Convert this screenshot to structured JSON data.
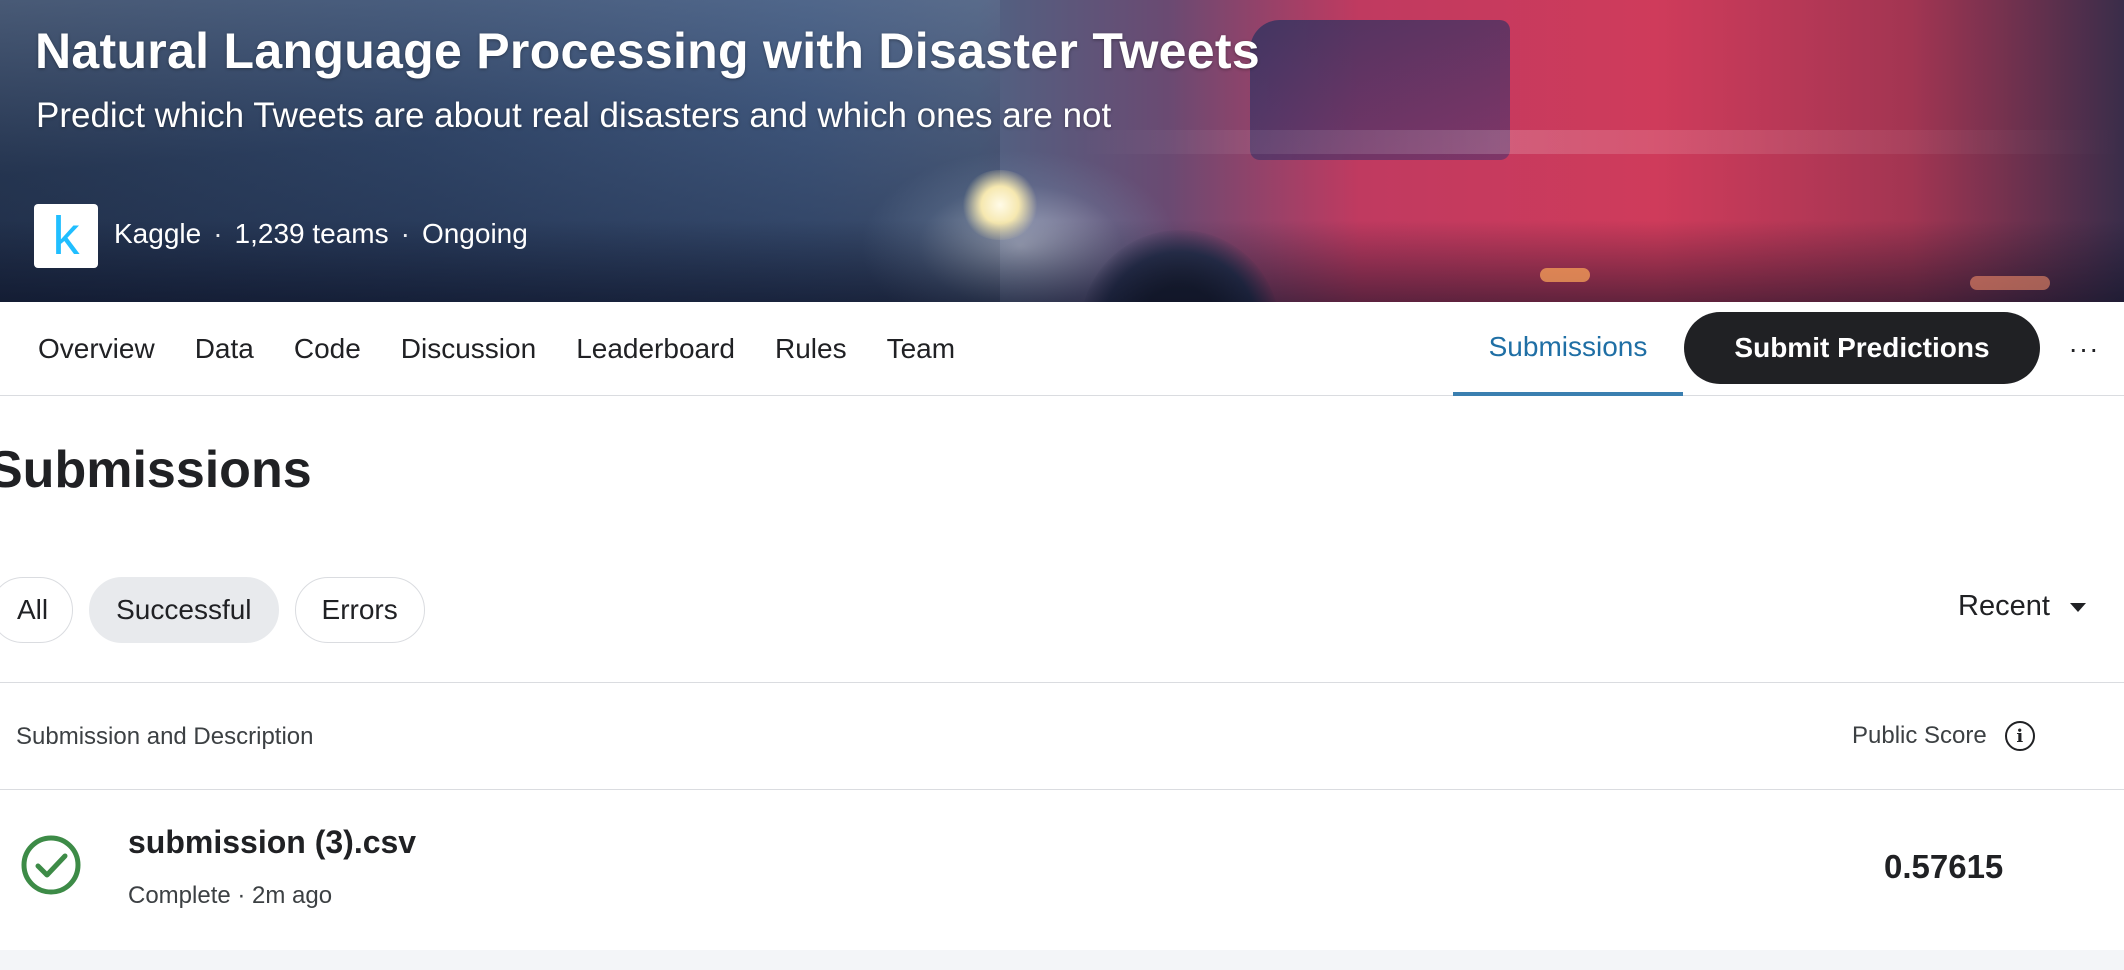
{
  "hero": {
    "title": "Natural Language Processing with Disaster Tweets",
    "subtitle": "Predict which Tweets are about real disasters and which ones are not",
    "host_logo_letter": "k",
    "host_name": "Kaggle",
    "separator": "·",
    "teams": "1,239 teams",
    "status": "Ongoing"
  },
  "tabs": {
    "items": [
      "Overview",
      "Data",
      "Code",
      "Discussion",
      "Leaderboard",
      "Rules",
      "Team"
    ],
    "active": "Submissions",
    "submit_label": "Submit Predictions",
    "more_label": "···"
  },
  "submissions": {
    "page_title": "Submissions",
    "filters": [
      "All",
      "Successful",
      "Errors"
    ],
    "selected_filter": "Successful",
    "sort_label": "Recent",
    "column_left": "Submission and Description",
    "column_right": "Public Score",
    "rows": [
      {
        "file": "submission (3).csv",
        "meta": "Complete · 2m ago",
        "score": "0.57615",
        "status_icon": "check-circle-icon"
      }
    ]
  },
  "colors": {
    "accent_tab": "#1f6fa5",
    "success": "#3d8b47",
    "button_bg": "#202124",
    "kaggle_blue": "#20beff"
  }
}
